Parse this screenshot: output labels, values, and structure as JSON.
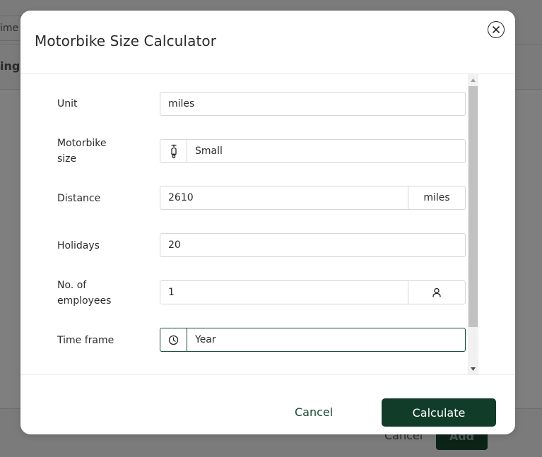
{
  "background": {
    "column_fragment": "ime",
    "heading_fragment": "ing",
    "cancel_label": "Cancel",
    "add_label": "Add"
  },
  "modal": {
    "title": "Motorbike Size Calculator",
    "close_icon": "close-circle-icon",
    "fields": {
      "unit": {
        "label": "Unit",
        "value": "miles"
      },
      "motorbike_size": {
        "label_line1": "Motorbike",
        "label_line2": "size",
        "value": "Small",
        "prefix_icon": "scooter-icon"
      },
      "distance": {
        "label": "Distance",
        "value": "2610",
        "suffix": "miles"
      },
      "holidays": {
        "label": "Holidays",
        "value": "20"
      },
      "employees": {
        "label_line1": "No. of",
        "label_line2": "employees",
        "value": "1",
        "suffix_icon": "person-icon"
      },
      "time_frame": {
        "label": "Time frame",
        "value": "Year",
        "prefix_icon": "clock-icon"
      }
    },
    "footer": {
      "cancel_label": "Cancel",
      "calculate_label": "Calculate"
    }
  },
  "colors": {
    "primary": "#113c2a",
    "focus_border": "#174a33",
    "overlay": "#7f7f7f"
  }
}
